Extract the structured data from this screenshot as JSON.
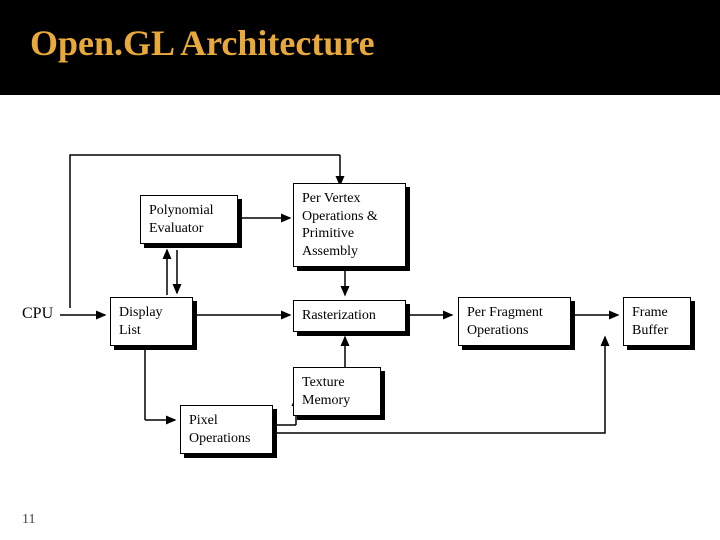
{
  "title": "Open.GL Architecture",
  "page_number": "11",
  "colors": {
    "title": "#e8a93a",
    "bg_top": "#000000",
    "bg_canvas": "#ffffff"
  },
  "labels": {
    "cpu": "CPU",
    "polynomial": "Polynomial\nEvaluator",
    "pervertex": "Per Vertex\nOperations &\nPrimitive\nAssembly",
    "display": "Display\nList",
    "raster": "Rasterization",
    "perfrag": "Per Fragment\nOperations",
    "frame": "Frame\nBuffer",
    "texture": "Texture\nMemory",
    "pixel": "Pixel\nOperations"
  }
}
